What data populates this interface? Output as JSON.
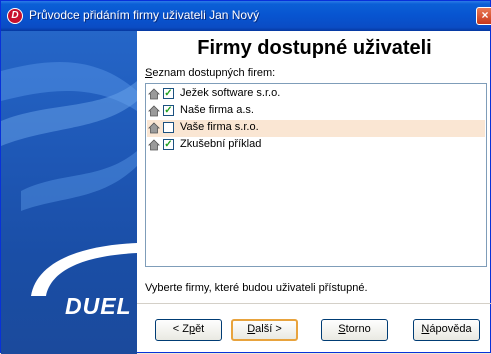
{
  "window": {
    "title": "Průvodce přidáním firmy uživateli Jan Nový",
    "icon_letter": "D",
    "close_glyph": "×"
  },
  "banner": {
    "logo_text": "DUEL"
  },
  "main": {
    "heading": "Firmy dostupné uživateli",
    "list_label_prefix": "S",
    "list_label_rest": "eznam dostupných firem:",
    "footer_text": "Vyberte firmy, které budou uživateli přístupné."
  },
  "list": {
    "items": [
      {
        "label": "Ježek software s.r.o.",
        "checked": true
      },
      {
        "label": "Naše firma a.s.",
        "checked": true
      },
      {
        "label": "Vaše firma s.r.o.",
        "checked": false,
        "selected": true
      },
      {
        "label": "Zkušební příklad",
        "checked": true
      }
    ]
  },
  "buttons": {
    "back_pre": "< Z",
    "back_key": "p",
    "back_post": "ět",
    "next_key": "D",
    "next_post": "alší >",
    "cancel_key": "S",
    "cancel_post": "torno",
    "help_key": "N",
    "help_post": "ápověda"
  },
  "colors": {
    "title_bar": "#0854d0",
    "banner": "#1e57b5",
    "selection": "#fae6d3",
    "check": "#21a121"
  }
}
